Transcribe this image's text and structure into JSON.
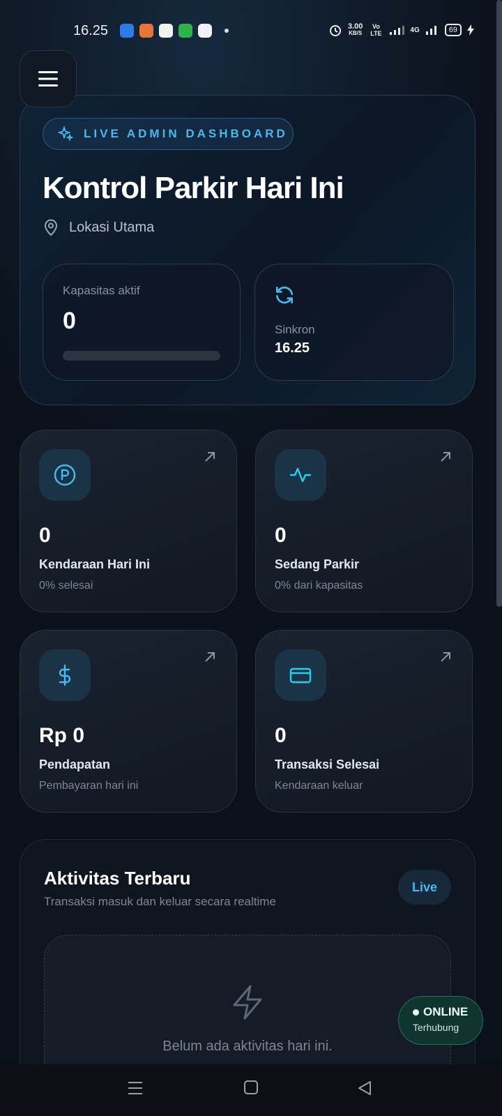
{
  "status_bar": {
    "time": "16.25",
    "net_speed_value": "3.00",
    "net_speed_unit": "KB/S",
    "volte": "Vo LTE",
    "network": "4G",
    "battery": "69"
  },
  "hero": {
    "badge": "LIVE ADMIN DASHBOARD",
    "title": "Kontrol Parkir Hari Ini",
    "location": "Lokasi Utama",
    "capacity": {
      "label": "Kapasitas aktif",
      "value": "0",
      "progress": 0
    },
    "sync": {
      "label": "Sinkron",
      "value": "16.25"
    }
  },
  "stats": [
    {
      "value": "0",
      "label": "Kendaraan Hari Ini",
      "sub": "0% selesai",
      "icon": "parking-icon"
    },
    {
      "value": "0",
      "label": "Sedang Parkir",
      "sub": "0% dari kapasitas",
      "icon": "activity-icon"
    },
    {
      "value": "Rp 0",
      "label": "Pendapatan",
      "sub": "Pembayaran hari ini",
      "icon": "dollar-icon"
    },
    {
      "value": "0",
      "label": "Transaksi Selesai",
      "sub": "Kendaraan keluar",
      "icon": "credit-card-icon"
    }
  ],
  "activity": {
    "title": "Aktivitas Terbaru",
    "subtitle": "Transaksi masuk dan keluar secara realtime",
    "live_label": "Live",
    "empty_text": "Belum ada aktivitas hari ini."
  },
  "connection": {
    "status": "ONLINE",
    "detail": "Terhubung"
  },
  "colors": {
    "accent": "#4db8ee",
    "background": "#0b111b",
    "online_bg": "#10342e"
  }
}
